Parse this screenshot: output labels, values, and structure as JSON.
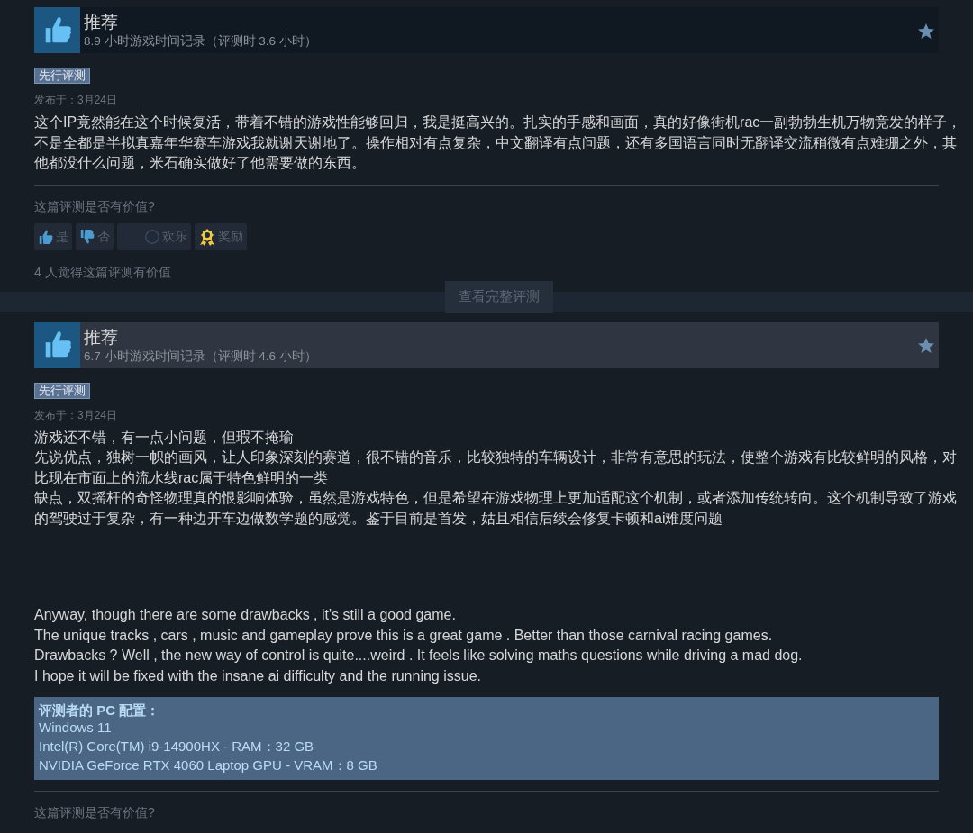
{
  "reviews": [
    {
      "verdict": "推荐",
      "highlighted": false,
      "hours": "8.9 小时游戏时间记录（评测时 3.6 小时）",
      "tag": "先行评测",
      "posted": "发布于：3月24日",
      "body": [
        [
          "这个IP竟然能在这个时候复活，带着不错的游戏性能够回归，我是挺高兴的。扎实的手感和画面，真的好像街机rac一副勃勃生机万物竞发的样子，不是全都是半拟真嘉年华赛车游戏我就谢天谢地了。操作相对有点复杂，中文翻译有点问题，还有多国语言同时无翻译交流稍微有点难绷之外，其他都没什么问题，米石确实做好了他需要做的东西。"
        ]
      ],
      "helpful_prompt": "这篇评测是否有价值?",
      "votes": [
        {
          "kind": "up",
          "label": "是"
        },
        {
          "kind": "down",
          "label": "否"
        },
        {
          "kind": "funny",
          "label": "欢乐"
        },
        {
          "kind": "award",
          "label": "奖励"
        }
      ],
      "helpful_count": "4 人觉得这篇评测有价值"
    },
    {
      "verdict": "推荐",
      "highlighted": true,
      "hours": "6.7 小时游戏时间记录（评测时 4.6 小时）",
      "tag": "先行评测",
      "posted": "发布于：3月24日",
      "body": [
        [
          "游戏还不错，有一点小问题，但瑕不掩瑜",
          "先说优点，独树一帜的画风，让人印象深刻的赛道，很不错的音乐，比较独特的车辆设计，非常有意思的玩法，使整个游戏有比较鲜明的风格，对比现在市面上的流水线rac属于特色鲜明的一类",
          "缺点，双摇杆的奇怪物理真的恨影响体验，虽然是游戏特色，但是希望在游戏物理上更加适配这个机制，或者添加传统转向。这个机制导致了游戏的驾驶过于复杂，有一种边开车边做数学题的感觉。鉴于目前是首发，姑且相信后续会修复卡顿和ai难度问题"
        ],
        [
          "Anyway, though there are some drawbacks , it's still a good game.",
          "The unique tracks , cars , music and gameplay prove this is a great game . Better than those carnival racing games.",
          "Drawbacks ? Well , the new way of control is quite....weird . It feels like solving maths questions while driving a mad dog.",
          "I hope it will be fixed with the insane ai difficulty and the running issue."
        ]
      ],
      "specs": {
        "title": "评测者的 PC 配置：",
        "lines": [
          "Windows 11",
          "Intel(R) Core(TM) i9-14900HX - RAM：32 GB",
          "NVIDIA GeForce RTX 4060 Laptop GPU - VRAM：8 GB"
        ]
      },
      "helpful_prompt": "这篇评测是否有价值?"
    }
  ],
  "full_review_button": "查看完整评测"
}
